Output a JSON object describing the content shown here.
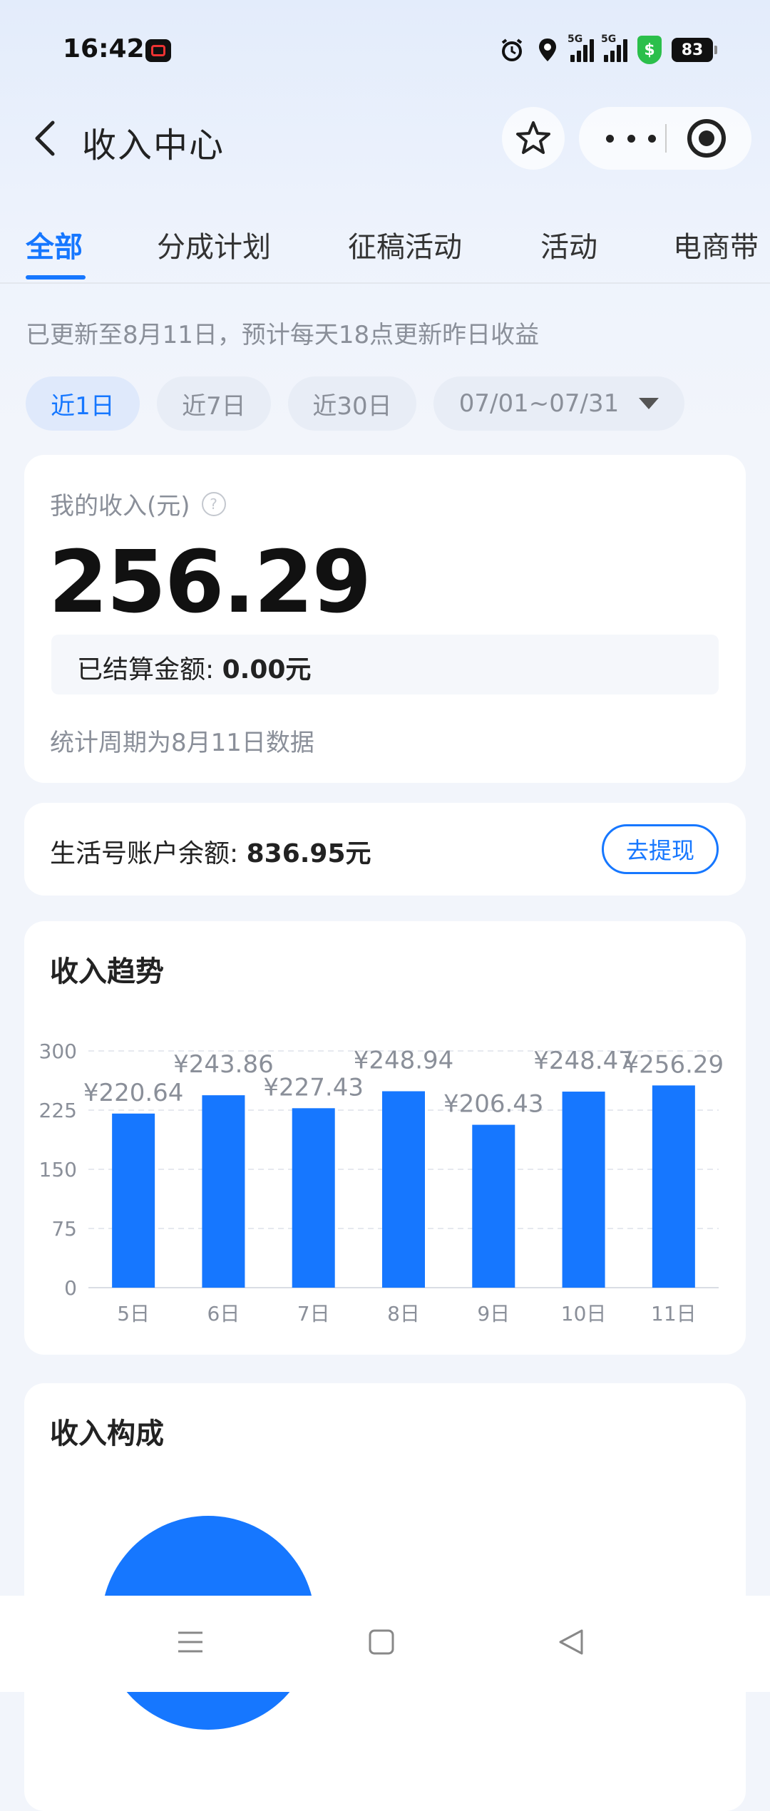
{
  "status_bar": {
    "time": "16:42",
    "icons": [
      "record-icon",
      "alarm-icon",
      "location-icon",
      "signal-5g-icon",
      "signal-5g-icon",
      "security-shield-icon",
      "battery-icon"
    ],
    "battery": "83",
    "signal_tag": "5G",
    "shield_symbol": "$"
  },
  "nav": {
    "title": "收入中心"
  },
  "tabs": [
    {
      "label": "全部"
    },
    {
      "label": "分成计划"
    },
    {
      "label": "征稿活动"
    },
    {
      "label": "活动"
    },
    {
      "label": "电商带"
    }
  ],
  "update_note": "已更新至8月11日，预计每天18点更新昨日收益",
  "date_chips": [
    {
      "label": "近1日"
    },
    {
      "label": "近7日"
    },
    {
      "label": "近30日"
    },
    {
      "label": "07/01~07/31"
    }
  ],
  "income": {
    "label": "我的收入(元)",
    "help": "?",
    "amount": "256.29",
    "settled_label": "已结算金额:",
    "settled_value": "0.00元",
    "period": "统计周期为8月11日数据"
  },
  "balance": {
    "label": "生活号账户余额:",
    "value": "836.95元",
    "withdraw": "去提现"
  },
  "trend": {
    "title": "收入趋势"
  },
  "chart_data": {
    "type": "bar",
    "title": "收入趋势",
    "categories": [
      "5日",
      "6日",
      "7日",
      "8日",
      "9日",
      "10日",
      "11日"
    ],
    "values": [
      220.64,
      243.86,
      227.43,
      248.94,
      206.43,
      248.47,
      256.29
    ],
    "value_labels": [
      "¥220.64",
      "¥243.86",
      "¥227.43",
      "¥248.94",
      "¥206.43",
      "¥248.47",
      "¥256.29"
    ],
    "yticks": [
      "300",
      "225",
      "150",
      "75",
      "0"
    ],
    "ylim": [
      0,
      300
    ],
    "grid": true,
    "bar_color": "#1677ff"
  },
  "composition": {
    "title": "收入构成",
    "pie_color": "#1677ff"
  },
  "colors": {
    "accent": "#1677ff",
    "muted": "#8a8f99"
  }
}
